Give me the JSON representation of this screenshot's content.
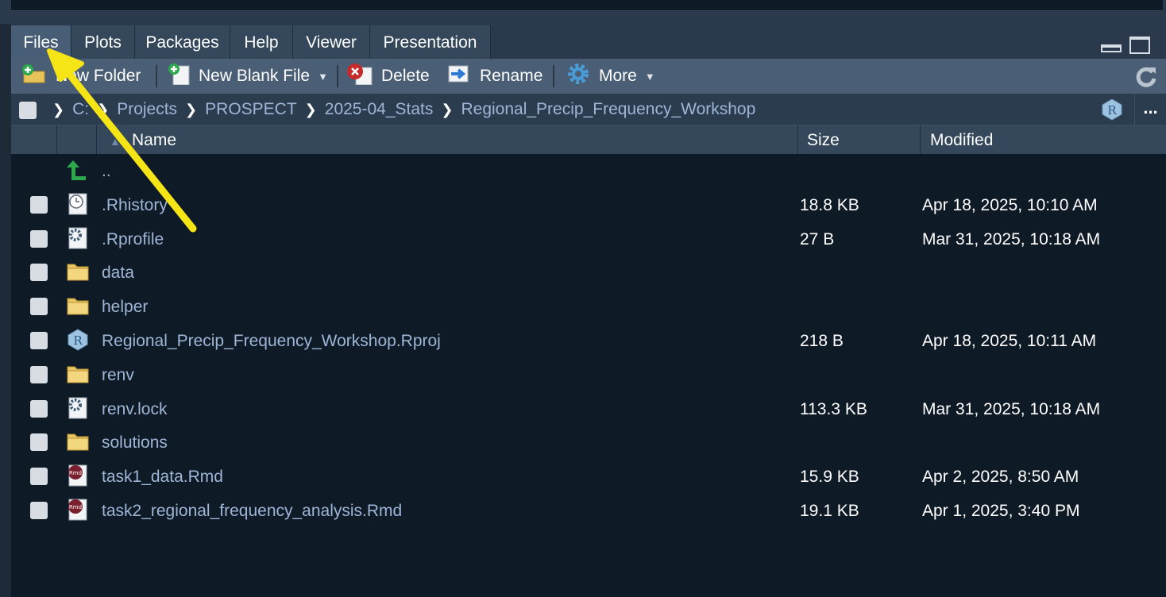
{
  "tabs": [
    {
      "label": "Files",
      "active": true
    },
    {
      "label": "Plots",
      "active": false
    },
    {
      "label": "Packages",
      "active": false
    },
    {
      "label": "Help",
      "active": false
    },
    {
      "label": "Viewer",
      "active": false
    },
    {
      "label": "Presentation",
      "active": false
    }
  ],
  "toolbar": {
    "new_folder": "New Folder",
    "new_blank_file": "New Blank File",
    "delete": "Delete",
    "rename": "Rename",
    "more": "More"
  },
  "breadcrumb": [
    "C:",
    "Projects",
    "PROSPECT",
    "2025-04_Stats",
    "Regional_Precip_Frequency_Workshop"
  ],
  "more_menu": "...",
  "columns": {
    "name": "Name",
    "size": "Size",
    "modified": "Modified"
  },
  "files": [
    {
      "name": "..",
      "type": "parent",
      "size": "",
      "modified": ""
    },
    {
      "name": ".Rhistory",
      "type": "history",
      "size": "18.8 KB",
      "modified": "Apr 18, 2025, 10:10 AM"
    },
    {
      "name": ".Rprofile",
      "type": "settings",
      "size": "27 B",
      "modified": "Mar 31, 2025, 10:18 AM"
    },
    {
      "name": "data",
      "type": "folder",
      "size": "",
      "modified": ""
    },
    {
      "name": "helper",
      "type": "folder",
      "size": "",
      "modified": ""
    },
    {
      "name": "Regional_Precip_Frequency_Workshop.Rproj",
      "type": "rproj",
      "size": "218 B",
      "modified": "Apr 18, 2025, 10:11 AM"
    },
    {
      "name": "renv",
      "type": "folder",
      "size": "",
      "modified": ""
    },
    {
      "name": "renv.lock",
      "type": "settings",
      "size": "113.3 KB",
      "modified": "Mar 31, 2025, 10:18 AM"
    },
    {
      "name": "solutions",
      "type": "folder",
      "size": "",
      "modified": ""
    },
    {
      "name": "task1_data.Rmd",
      "type": "rmd",
      "size": "15.9 KB",
      "modified": "Apr 2, 2025, 8:50 AM"
    },
    {
      "name": "task2_regional_frequency_analysis.Rmd",
      "type": "rmd",
      "size": "19.1 KB",
      "modified": "Apr 1, 2025, 3:40 PM"
    }
  ]
}
